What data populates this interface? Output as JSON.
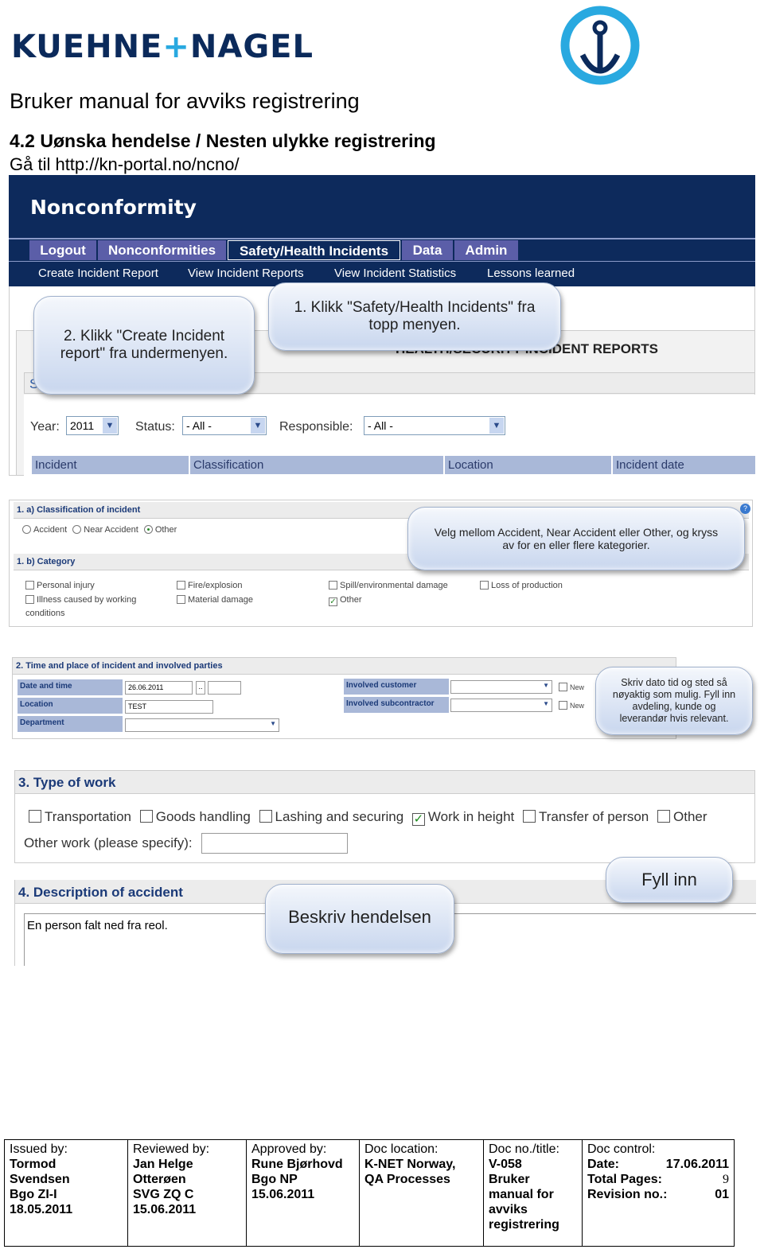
{
  "header": {
    "logo_text_1": "KUEHNE",
    "logo_plus": "+",
    "logo_text_2": "NAGEL",
    "logo_icon": "anchor-icon",
    "brand_colors": {
      "navy": "#0b2a5b",
      "cyan": "#29a9e0"
    },
    "title": "Bruker manual  for avviks registrering",
    "section_heading": "4.2 Uønska hendelse / Nesten ulykke registrering",
    "goto_text": "Gå til http://kn-portal.no/ncno/"
  },
  "shot1": {
    "app_title": "Nonconformity",
    "tabs": [
      {
        "label": "Logout"
      },
      {
        "label": "Nonconformities"
      },
      {
        "label": "Safety/Health Incidents",
        "selected": true
      },
      {
        "label": "Data"
      },
      {
        "label": "Admin"
      }
    ],
    "submenu": [
      "Create Incident Report",
      "View Incident Reports",
      "View Incident Statistics",
      "Lessons learned"
    ],
    "page_heading": "HEALTH/SECURITY INCIDENT REPORTS",
    "select_reports": "Select reports to view",
    "filters": {
      "year_label": "Year:",
      "year_value": "2011",
      "status_label": "Status:",
      "status_value": "- All -",
      "responsible_label": "Responsible:",
      "responsible_value": "- All -"
    },
    "columns": [
      "Incident",
      "Classification",
      "Location",
      "Incident date"
    ],
    "callout_1": "1. Klikk \"Safety/Health Incidents\" fra topp menyen.",
    "callout_2": "2. Klikk \"Create Incident report\" fra undermenyen."
  },
  "shot2": {
    "section_a": "1. a) Classification of incident",
    "radios": [
      {
        "label": "Accident",
        "checked": false
      },
      {
        "label": "Near Accident",
        "checked": false
      },
      {
        "label": "Other",
        "checked": true
      }
    ],
    "section_b": "1. b) Category",
    "categories": [
      {
        "label": "Personal injury",
        "checked": false
      },
      {
        "label": "Illness caused by working conditions",
        "checked": false
      },
      {
        "label": "Fire/explosion",
        "checked": false
      },
      {
        "label": "Material damage",
        "checked": false
      },
      {
        "label": "Spill/environmental damage",
        "checked": false
      },
      {
        "label": "Other",
        "checked": true
      },
      {
        "label": "Loss of production",
        "checked": false
      }
    ],
    "help_icon": "help-icon",
    "callout": "Velg mellom Accident, Near Accident eller Other, og kryss av for en eller flere kategorier."
  },
  "shot3": {
    "section": "2. Time and place of incident and involved parties",
    "date_label": "Date and time",
    "date_value": "26.06.2011",
    "date_button": "..",
    "location_label": "Location",
    "location_value": "TEST",
    "department_label": "Department",
    "customer_label": "Involved customer",
    "subcontractor_label": "Involved subcontractor",
    "new_label": "New",
    "callout": "Skriv dato tid og sted så nøyaktig som mulig. Fyll inn avdeling, kunde og leverandør hvis relevant."
  },
  "shot4": {
    "section3": "3. Type of work",
    "work_types": [
      {
        "label": "Transportation",
        "checked": false
      },
      {
        "label": "Goods handling",
        "checked": false
      },
      {
        "label": "Lashing and securing",
        "checked": false
      },
      {
        "label": "Work in height",
        "checked": true
      },
      {
        "label": "Transfer of person",
        "checked": false
      },
      {
        "label": "Other",
        "checked": false
      }
    ],
    "other_work_label": "Other work (please specify):",
    "callout_fill": "Fyll inn",
    "section4": "4. Description of accident",
    "description": "En person falt ned fra reol.",
    "callout_describe": "Beskriv hendelsen"
  },
  "footer": {
    "issued_label": "Issued by:",
    "issued": [
      "Tormod",
      "Svendsen",
      "Bgo ZI-I",
      "18.05.2011"
    ],
    "reviewed_label": "Reviewed by:",
    "reviewed": [
      "Jan Helge",
      "Otterøen",
      "SVG ZQ C",
      "15.06.2011"
    ],
    "approved_label": "Approved by:",
    "approved": [
      "Rune Bjørhovd",
      "Bgo NP",
      "15.06.2011"
    ],
    "location_label": "Doc location:",
    "location": [
      "K-NET Norway,",
      "QA Processes"
    ],
    "docno_label": "Doc no./title:",
    "docno": [
      "V-058",
      "Bruker",
      "manual for",
      "avviks",
      "registrering"
    ],
    "control_label": "Doc control:",
    "date_key": "Date:",
    "date_val": "17.06.2011",
    "pages_key": "Total Pages:",
    "pages_val": "9",
    "rev_key": "Revision no.:",
    "rev_val": "01"
  }
}
